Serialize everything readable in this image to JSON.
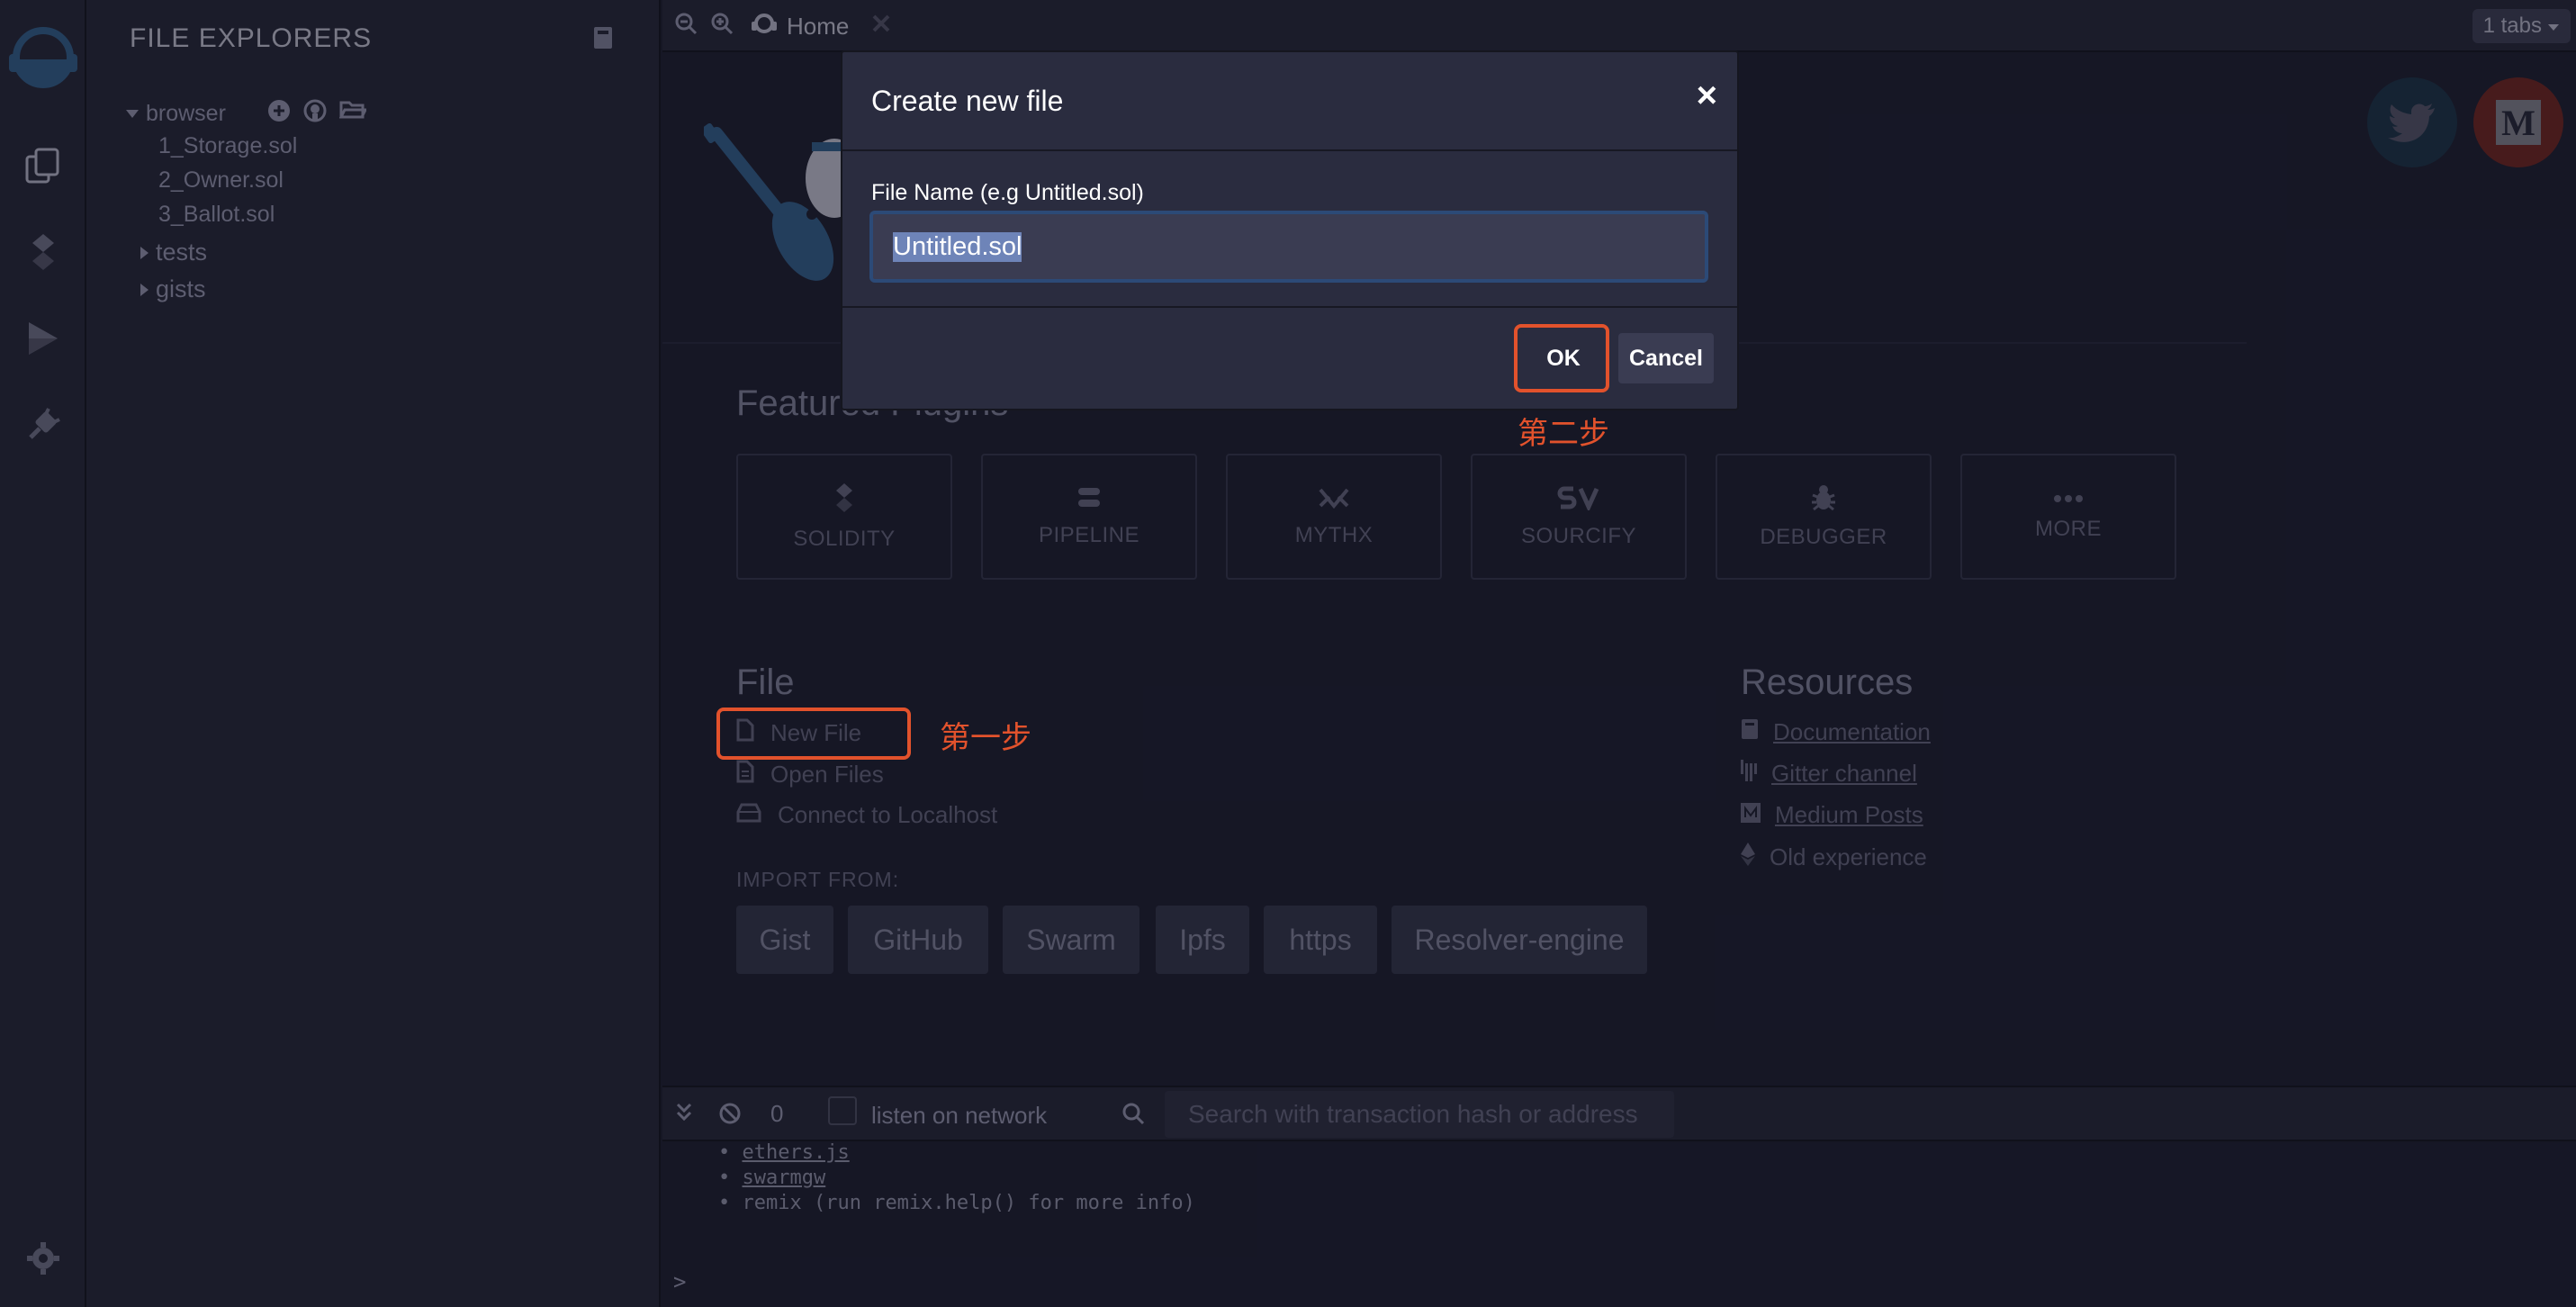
{
  "sidebar": {
    "title": "FILE EXPLORERS",
    "tree": {
      "root_label": "browser",
      "files": [
        "1_Storage.sol",
        "2_Owner.sol",
        "3_Ballot.sol"
      ],
      "folders": [
        "tests",
        "gists"
      ]
    }
  },
  "tabs": {
    "home_label": "Home",
    "count_label": "1 tabs"
  },
  "home": {
    "featured_heading": "Featured Plugins",
    "plugins": [
      "SOLIDITY",
      "PIPELINE",
      "MYTHX",
      "SOURCIFY",
      "DEBUGGER",
      "MORE"
    ],
    "file_heading": "File",
    "file_links": [
      "New File",
      "Open Files",
      "Connect to Localhost"
    ],
    "import_label": "IMPORT FROM:",
    "import_buttons": [
      "Gist",
      "GitHub",
      "Swarm",
      "Ipfs",
      "https",
      "Resolver-engine"
    ],
    "resources_heading": "Resources",
    "resources": [
      "Documentation",
      "Gitter channel",
      "Medium Posts",
      "Old experience"
    ]
  },
  "annotations": {
    "step1": "第一步",
    "step2": "第二步",
    "color": "#e2522c"
  },
  "terminal": {
    "pending_count": "0",
    "listen_label": "listen on network",
    "search_placeholder": "Search with transaction hash or address",
    "lines": [
      "ethers.js",
      "swarmgw",
      "remix (run remix.help() for more info)"
    ],
    "prompt": ">"
  },
  "modal": {
    "title": "Create new file",
    "close": "×",
    "field_label": "File Name (e.g Untitled.sol)",
    "filename_value": "Untitled.sol",
    "ok_label": "OK",
    "cancel_label": "Cancel"
  },
  "colors": {
    "background": "#222336",
    "panel": "#2a2c3f",
    "accent_orange": "#e2522c",
    "twitter": "#1f3a4f",
    "medium": "#7a2a25"
  }
}
